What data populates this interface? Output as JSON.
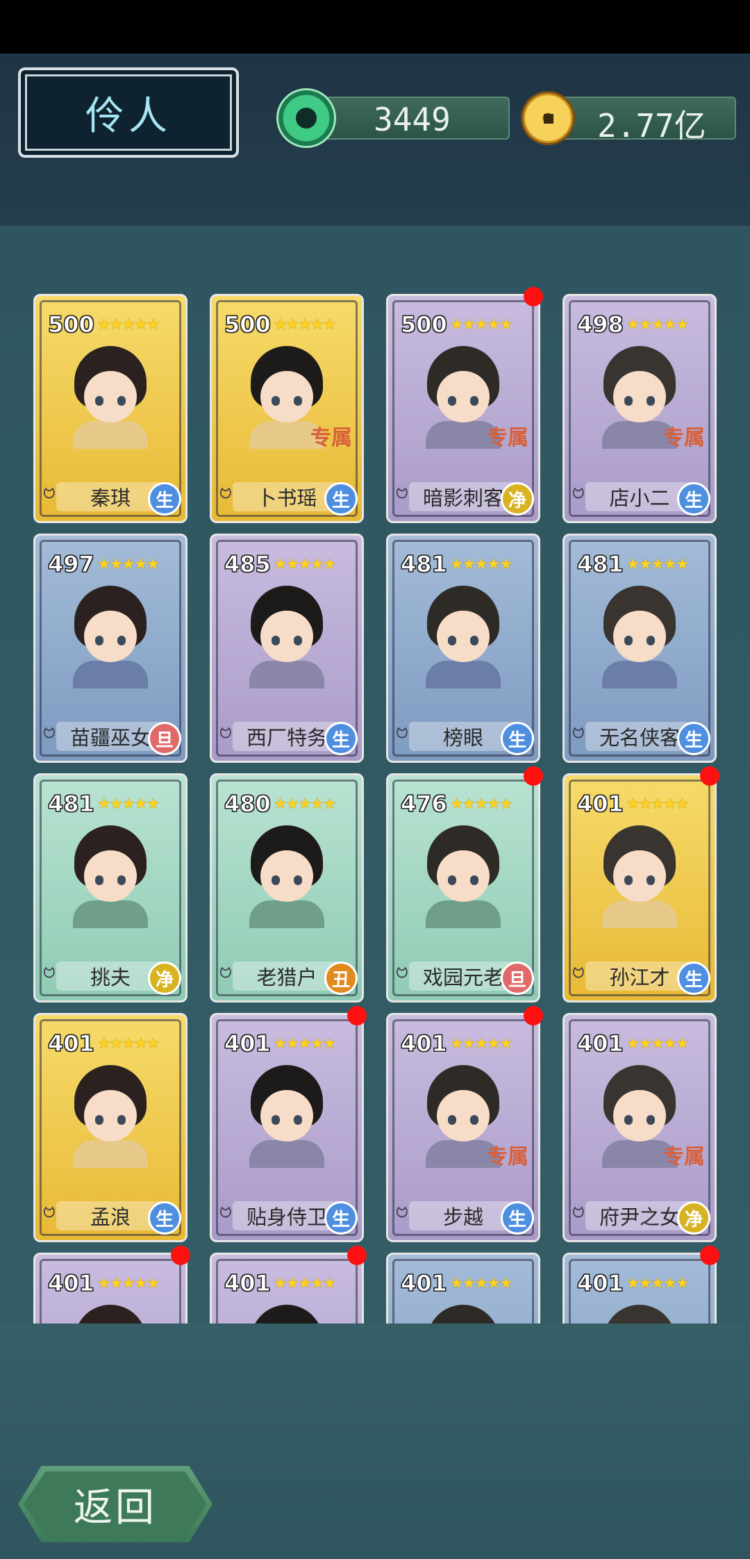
{
  "header": {
    "title": "伶人",
    "jade_amount": "3449",
    "coin_amount": "2.77亿"
  },
  "cards": [
    {
      "score": "500",
      "stars": "★★★★★",
      "name": "秦琪",
      "role": "生",
      "role_type": "sheng",
      "rarity": "gold",
      "exclusive": "",
      "badge": false
    },
    {
      "score": "500",
      "stars": "★★★★★",
      "name": "卜书瑶",
      "role": "生",
      "role_type": "sheng",
      "rarity": "gold",
      "exclusive": "专属",
      "badge": false
    },
    {
      "score": "500",
      "stars": "★★★★★",
      "name": "暗影刺客",
      "role": "净",
      "role_type": "jing",
      "rarity": "purple",
      "exclusive": "专属",
      "badge": true
    },
    {
      "score": "498",
      "stars": "★★★★★",
      "name": "店小二",
      "role": "生",
      "role_type": "sheng",
      "rarity": "purple",
      "exclusive": "专属",
      "badge": false
    },
    {
      "score": "497",
      "stars": "★★★★★",
      "name": "苗疆巫女",
      "role": "旦",
      "role_type": "dan",
      "rarity": "blue",
      "exclusive": "",
      "badge": false
    },
    {
      "score": "485",
      "stars": "★★★★★",
      "name": "西厂特务",
      "role": "生",
      "role_type": "sheng",
      "rarity": "purple",
      "exclusive": "",
      "badge": false
    },
    {
      "score": "481",
      "stars": "★★★★★",
      "name": "榜眼",
      "role": "生",
      "role_type": "sheng",
      "rarity": "blue",
      "exclusive": "",
      "badge": false
    },
    {
      "score": "481",
      "stars": "★★★★★",
      "name": "无名侠客",
      "role": "生",
      "role_type": "sheng",
      "rarity": "blue",
      "exclusive": "",
      "badge": false
    },
    {
      "score": "481",
      "stars": "★★★★★",
      "name": "挑夫",
      "role": "净",
      "role_type": "jing",
      "rarity": "green",
      "exclusive": "",
      "badge": false
    },
    {
      "score": "480",
      "stars": "★★★★★",
      "name": "老猎户",
      "role": "丑",
      "role_type": "chou",
      "rarity": "green",
      "exclusive": "",
      "badge": false
    },
    {
      "score": "476",
      "stars": "★★★★★",
      "name": "戏园元老",
      "role": "旦",
      "role_type": "dan",
      "rarity": "green",
      "exclusive": "",
      "badge": true
    },
    {
      "score": "401",
      "stars": "★★★★★",
      "name": "孙江才",
      "role": "生",
      "role_type": "sheng",
      "rarity": "gold",
      "exclusive": "",
      "badge": true
    },
    {
      "score": "401",
      "stars": "★★★★★",
      "name": "孟浪",
      "role": "生",
      "role_type": "sheng",
      "rarity": "gold",
      "exclusive": "",
      "badge": false
    },
    {
      "score": "401",
      "stars": "★★★★★",
      "name": "贴身侍卫",
      "role": "生",
      "role_type": "sheng",
      "rarity": "purple",
      "exclusive": "",
      "badge": true
    },
    {
      "score": "401",
      "stars": "★★★★★",
      "name": "步越",
      "role": "生",
      "role_type": "sheng",
      "rarity": "purple",
      "exclusive": "专属",
      "badge": true
    },
    {
      "score": "401",
      "stars": "★★★★★",
      "name": "府尹之女",
      "role": "净",
      "role_type": "jing",
      "rarity": "purple",
      "exclusive": "专属",
      "badge": false
    },
    {
      "score": "401",
      "stars": "★★★★★",
      "name": "",
      "role": "",
      "role_type": "sheng",
      "rarity": "purple",
      "exclusive": "",
      "badge": true
    },
    {
      "score": "401",
      "stars": "★★★★★",
      "name": "",
      "role": "",
      "role_type": "sheng",
      "rarity": "purple",
      "exclusive": "",
      "badge": true
    },
    {
      "score": "401",
      "stars": "★★★★★",
      "name": "",
      "role": "",
      "role_type": "sheng",
      "rarity": "blue",
      "exclusive": "",
      "badge": false
    },
    {
      "score": "401",
      "stars": "★★★★★",
      "name": "",
      "role": "",
      "role_type": "sheng",
      "rarity": "blue",
      "exclusive": "",
      "badge": true
    }
  ],
  "footer": {
    "back_label": "返回"
  }
}
